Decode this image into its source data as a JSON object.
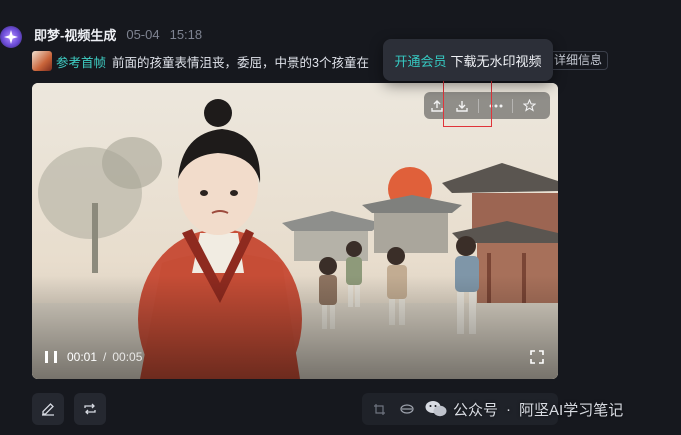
{
  "header": {
    "app_name": "即梦-视频生成",
    "date": "05-04",
    "time": "15:18"
  },
  "prompt": {
    "reference_label": "参考首帧",
    "text": "前面的孩童表情沮丧，委屈，中景的3个孩童在",
    "detail_button": "详细信息"
  },
  "tooltip": {
    "vip_link": "开通会员",
    "message": "下载无水印视频"
  },
  "video_toolbar": {
    "icons": [
      "share-icon",
      "download-icon",
      "more-icon",
      "star-icon"
    ]
  },
  "player": {
    "current_time": "00:01",
    "separator": "/",
    "total_time": "00:05",
    "state": "paused-control-shown"
  },
  "bottom_actions": {
    "left_icons": [
      "edit-icon",
      "regenerate-icon"
    ],
    "right_icons": [
      "crop-icon",
      "lip-sync-icon"
    ]
  },
  "watermark": {
    "platform": "公众号",
    "account": "阿坚AI学习笔记"
  },
  "colors": {
    "background": "#16181e",
    "accent_teal": "#3fd0c6",
    "highlight_red": "#e0343a",
    "tooltip_bg": "#2c2f38"
  }
}
